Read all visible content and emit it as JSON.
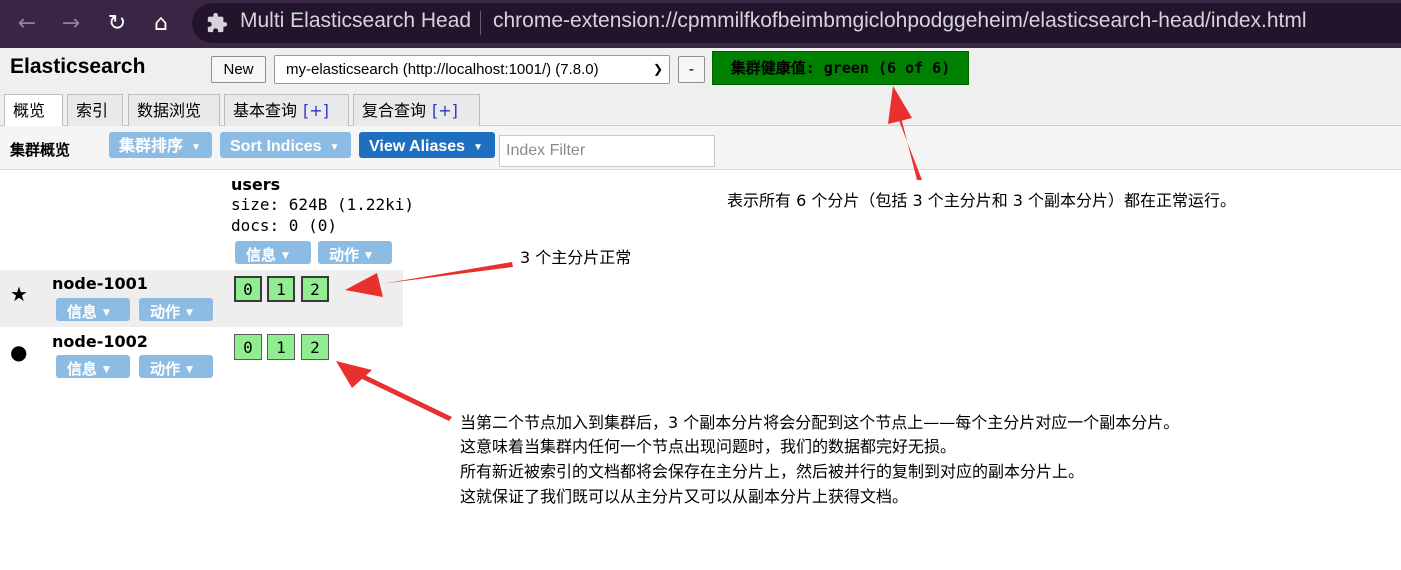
{
  "browser": {
    "tab_title": "Multi Elasticsearch Head",
    "url": "chrome-extension://cpmmilfkofbeimbmgiclohpodggeheim/elasticsearch-head/index.html"
  },
  "header": {
    "brand": "Elasticsearch",
    "new_button": "New",
    "cluster_selected": "my-elasticsearch (http://localhost:1001/) (7.8.0)",
    "minus_button": "-",
    "health": "集群健康值: green (6 of 6)",
    "health_color": "#008000"
  },
  "tabs": [
    {
      "label": "概览",
      "plus": ""
    },
    {
      "label": "索引",
      "plus": ""
    },
    {
      "label": "数据浏览",
      "plus": ""
    },
    {
      "label": "基本查询",
      "plus": "[+]"
    },
    {
      "label": "复合查询",
      "plus": "[+]"
    }
  ],
  "toolbar": {
    "title": "集群概览",
    "sort_cluster": "集群排序",
    "sort_indices": "Sort Indices",
    "view_aliases": "View Aliases",
    "index_filter_placeholder": "Index Filter"
  },
  "index": {
    "name": "users",
    "size": "size: 624B (1.22ki)",
    "docs": "docs: 0 (0)",
    "info_button": "信息",
    "action_button": "动作"
  },
  "nodes": [
    {
      "name": "node-1001",
      "icon": "star-icon",
      "info_button": "信息",
      "action_button": "动作",
      "shards": [
        "0",
        "1",
        "2"
      ]
    },
    {
      "name": "node-1002",
      "icon": "circle-icon",
      "info_button": "信息",
      "action_button": "动作",
      "shards": [
        "0",
        "1",
        "2"
      ]
    }
  ],
  "annotations": {
    "health_note": "表示所有 6 个分片（包括 3 个主分片和 3 个副本分片）都在正常运行。",
    "primary_note": "3 个主分片正常",
    "replica_lines": [
      "当第二个节点加入到集群后，3 个副本分片将会分配到这个节点上——每个主分片对应一个副本分片。",
      "这意味着当集群内任何一个节点出现问题时，我们的数据都完好无损。",
      "所有新近被索引的文档都将会保存在主分片上，然后被并行的复制到对应的副本分片上。",
      "这就保证了我们既可以从主分片又可以从副本分片上获得文档。"
    ],
    "arrow_color": "#e8312f"
  }
}
